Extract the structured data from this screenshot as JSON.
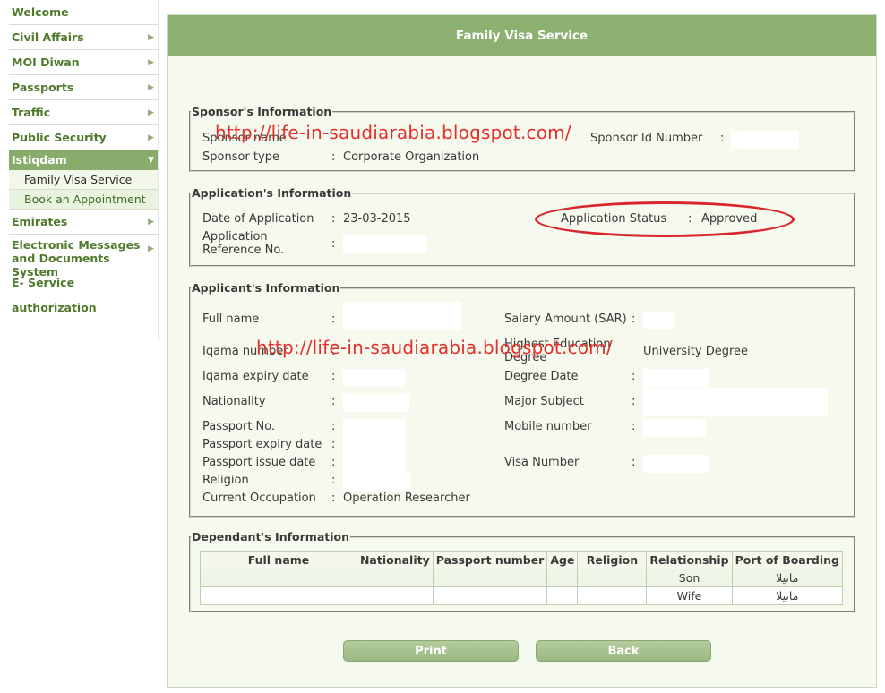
{
  "sidebar": {
    "items": [
      {
        "label": "Welcome"
      },
      {
        "label": "Civil Affairs"
      },
      {
        "label": "MOI Diwan"
      },
      {
        "label": "Passports"
      },
      {
        "label": "Traffic"
      },
      {
        "label": "Public Security"
      },
      {
        "label": "Istiqdam"
      },
      {
        "label": "Emirates"
      },
      {
        "label": "Electronic Messages and Documents System"
      },
      {
        "label": "E- Service authorization"
      }
    ],
    "subitems": [
      {
        "label": "Family Visa Service"
      },
      {
        "label": "Book an Appointment"
      }
    ]
  },
  "header": {
    "title": "Family Visa Service"
  },
  "watermark": "http://life-in-saudiarabia.blogspot.com/",
  "sponsor": {
    "legend": "Sponsor's Information",
    "name_label": "Sponsor name",
    "id_label": "Sponsor Id Number",
    "type_label": "Sponsor type",
    "type_value": "Corporate Organization"
  },
  "application": {
    "legend": "Application's Information",
    "date_label": "Date of Application",
    "date_value": "23-03-2015",
    "status_label": "Application Status",
    "status_value": "Approved",
    "ref_label": "Application Reference No."
  },
  "applicant": {
    "legend": "Applicant's Information",
    "full_name_label": "Full name",
    "iqama_label": "Iqama number",
    "iqama_expiry_label": "Iqama expiry date",
    "nationality_label": "Nationality",
    "passport_label": "Passport No.",
    "passport_expiry_label": "Passport expiry date",
    "passport_issue_label": "Passport issue date",
    "religion_label": "Religion",
    "occupation_label": "Current Occupation",
    "occupation_value": "Operation Researcher",
    "salary_label": "Salary Amount (SAR)",
    "education_label": "Highest Education Degree",
    "education_value": "University Degree",
    "degree_date_label": "Degree Date",
    "major_label": "Major Subject",
    "mobile_label": "Mobile number",
    "visa_label": "Visa Number"
  },
  "dependants": {
    "legend": "Dependant's Information",
    "columns": [
      "Full name",
      "Nationality",
      "Passport number",
      "Age",
      "Religion",
      "Relationship",
      "Port of Boarding"
    ],
    "rows": [
      {
        "relationship": "Son",
        "port": "مانيلا"
      },
      {
        "relationship": "Wife",
        "port": "مانيلا"
      }
    ]
  },
  "buttons": {
    "print": "Print",
    "back": "Back"
  },
  "colors": {
    "accent": "#8cb06f",
    "panel": "#f6f9ee",
    "highlight": "#d9252b"
  }
}
